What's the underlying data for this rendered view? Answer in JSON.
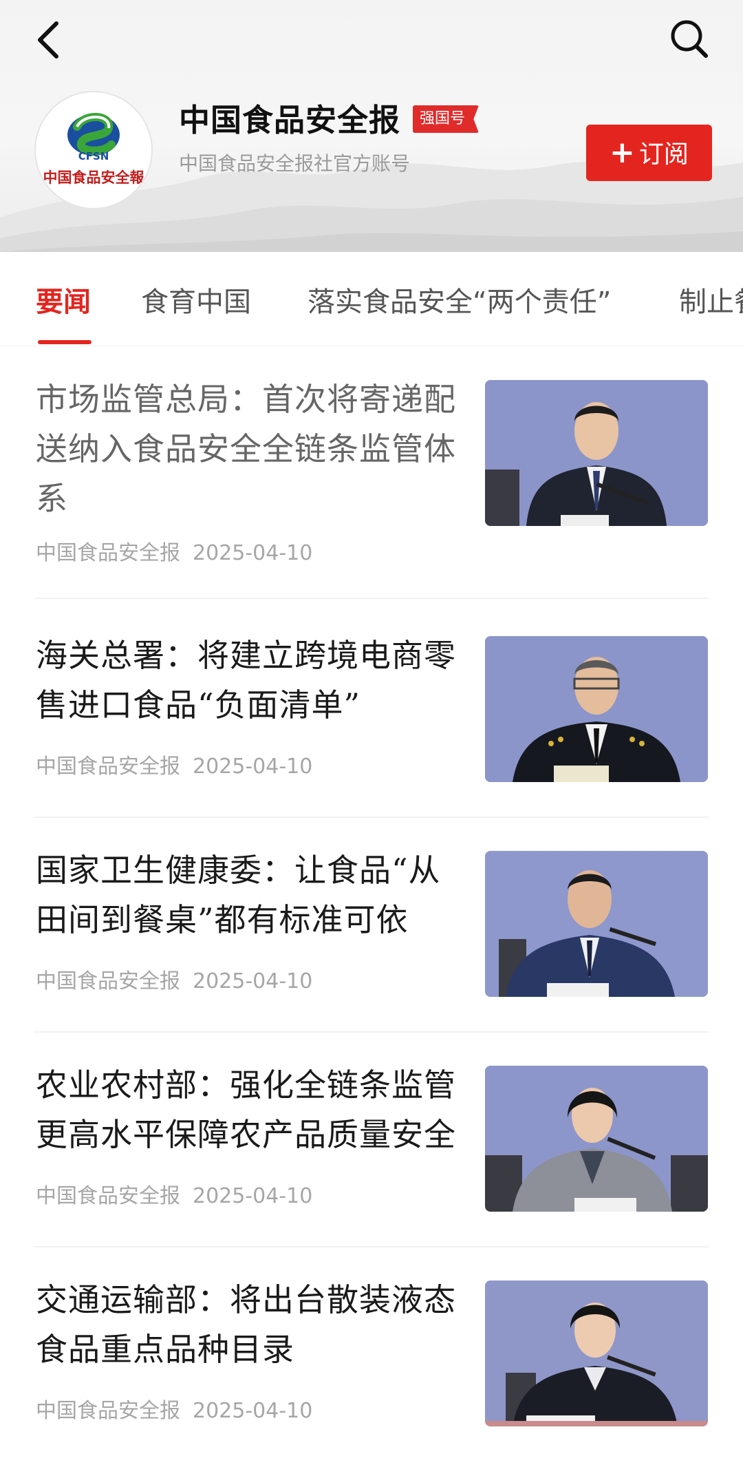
{
  "header": {
    "account_name": "中国食品安全报",
    "badge": "强国号",
    "description": "中国食品安全报社官方账号",
    "subscribe_label": "订阅",
    "logo_text": "CFSN",
    "logo_caption": "中国食品安全報"
  },
  "tabs": [
    {
      "label": "要闻",
      "active": true
    },
    {
      "label": "食育中国",
      "active": false
    },
    {
      "label": "落实食品安全“两个责任”",
      "active": false
    },
    {
      "label": "制止餐",
      "active": false
    }
  ],
  "articles": [
    {
      "title": "市场监管总局：首次将寄递配送纳入食品安全全链条监管体系",
      "source": "中国食品安全报",
      "date": "2025-04-10",
      "read": true,
      "thumb_icon": "press-conference-speaker-photo"
    },
    {
      "title": "海关总署：将建立跨境电商零售进口食品“负面清单”",
      "source": "中国食品安全报",
      "date": "2025-04-10",
      "read": false,
      "thumb_icon": "customs-official-speaker-photo"
    },
    {
      "title": "国家卫生健康委：让食品“从田间到餐桌”都有标准可依",
      "source": "中国食品安全报",
      "date": "2025-04-10",
      "read": false,
      "thumb_icon": "press-conference-speaker-photo"
    },
    {
      "title": "农业农村部：强化全链条监管更高水平保障农产品质量安全",
      "source": "中国食品安全报",
      "date": "2025-04-10",
      "read": false,
      "thumb_icon": "press-conference-speaker-photo"
    },
    {
      "title": "交通运输部：将出台散装液态食品重点品种目录",
      "source": "中国食品安全报",
      "date": "2025-04-10",
      "read": false,
      "thumb_icon": "press-conference-speaker-photo"
    }
  ],
  "colors": {
    "accent": "#e4251f",
    "thumb_bg": "#8f97c8"
  }
}
